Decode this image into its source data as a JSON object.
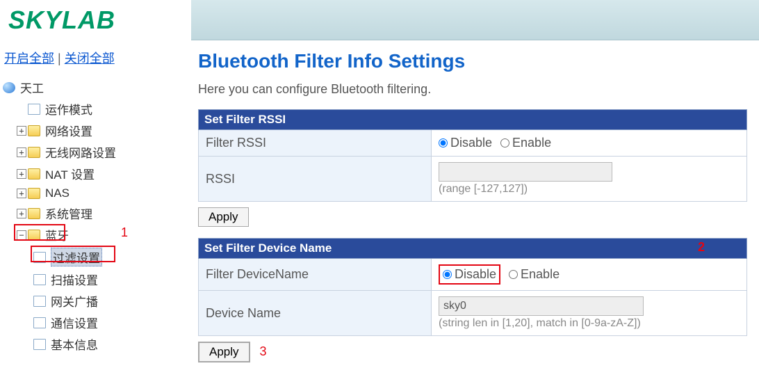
{
  "logo": "SKYLAB",
  "sidebar": {
    "open_all": "开启全部",
    "close_all": "关闭全部",
    "root": "天工",
    "items": [
      "运作模式",
      "网络设置",
      "无线网路设置",
      "NAT 设置",
      "NAS",
      "系统管理"
    ],
    "bt_group": "蓝牙",
    "bt_children": [
      "过滤设置",
      "扫描设置",
      "网关广播",
      "通信设置",
      "基本信息"
    ]
  },
  "annot": {
    "n1": "1",
    "n2": "2",
    "n3": "3"
  },
  "main": {
    "title": "Bluetooth Filter Info Settings",
    "desc": "Here you can configure Bluetooth filtering.",
    "section1": {
      "header": "Set Filter RSSI",
      "row1_label": "Filter RSSI",
      "row1_disable": "Disable",
      "row1_enable": "Enable",
      "row2_label": "RSSI",
      "row2_value": "",
      "row2_hint": "(range [-127,127])",
      "apply": "Apply"
    },
    "section2": {
      "header": "Set Filter Device Name",
      "row1_label": "Filter DeviceName",
      "row1_disable": "Disable",
      "row1_enable": "Enable",
      "row2_label": "Device Name",
      "row2_value": "sky0",
      "row2_hint": "(string len in [1,20], match in [0-9a-zA-Z])",
      "apply": "Apply"
    }
  }
}
